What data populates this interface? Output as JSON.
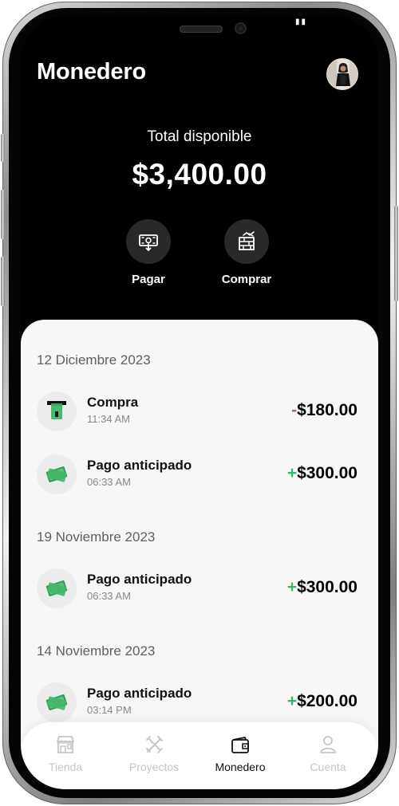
{
  "app": {
    "title": "Monedero"
  },
  "balance": {
    "label": "Total disponible",
    "amount": "$3,400.00"
  },
  "actions": [
    {
      "label": "Pagar",
      "icon": "payment-icon"
    },
    {
      "label": "Comprar",
      "icon": "brick-icon"
    }
  ],
  "transactions": [
    {
      "date": "12 Diciembre 2023",
      "items": [
        {
          "title": "Compra",
          "time": "11:34 AM",
          "sign": "-",
          "amount": "$180.00",
          "icon": "receipt-icon"
        },
        {
          "title": "Pago anticipado",
          "time": "06:33 AM",
          "sign": "+",
          "amount": "$300.00",
          "icon": "cash-icon"
        }
      ]
    },
    {
      "date": "19 Noviembre 2023",
      "items": [
        {
          "title": "Pago anticipado",
          "time": "06:33 AM",
          "sign": "+",
          "amount": "$300.00",
          "icon": "cash-icon"
        }
      ]
    },
    {
      "date": "14 Noviembre 2023",
      "items": [
        {
          "title": "Pago anticipado",
          "time": "03:14 PM",
          "sign": "+",
          "amount": "$200.00",
          "icon": "cash-icon"
        }
      ]
    }
  ],
  "nav": [
    {
      "label": "Tienda",
      "icon": "store-icon",
      "active": false
    },
    {
      "label": "Proyectos",
      "icon": "tools-icon",
      "active": false
    },
    {
      "label": "Monedero",
      "icon": "wallet-icon",
      "active": true
    },
    {
      "label": "Cuenta",
      "icon": "user-icon",
      "active": false
    }
  ],
  "colors": {
    "background": "#000000",
    "sheet": "#f7f7f7",
    "positive": "#38b768",
    "negative": "#a56f50",
    "cash_green": "#49b96f"
  }
}
